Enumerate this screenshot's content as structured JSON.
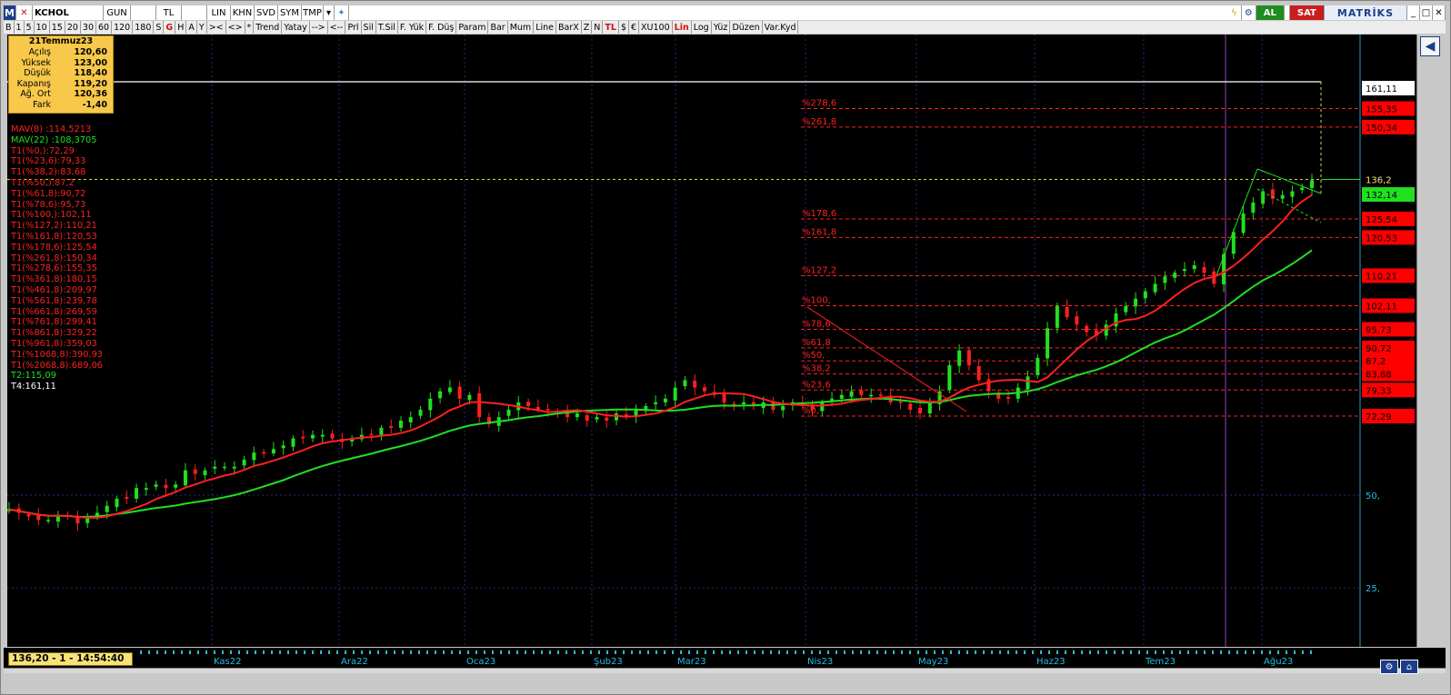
{
  "toolbar_top": {
    "logo": "M",
    "symbol": "KCHOL",
    "period": "GUN",
    "currency": "TL",
    "scale": "LIN",
    "khn": "KHN",
    "svd": "SVD",
    "sym": "SYM",
    "tmp": "TMP",
    "al_label": "AL",
    "sat_label": "SAT",
    "brand": "MATRİKS"
  },
  "toolbar_bottom": {
    "items": [
      "B",
      "1",
      "5",
      "10",
      "15",
      "20",
      "30",
      "60",
      "120",
      "180",
      "S",
      "G",
      "H",
      "A",
      "Y",
      "><",
      "<>",
      "*",
      "Trend",
      "Yatay",
      "-->",
      "<--",
      "Prl",
      "Sil",
      "T.Sil",
      "F. Yük",
      "F. Düş",
      "Param",
      "Bar",
      "Mum",
      "Line",
      "BarX",
      "Z",
      "N",
      "TL",
      "$",
      "€",
      "XU100",
      "Lin",
      "Log",
      "Yüz",
      "Düzen",
      "Var.Kyd"
    ],
    "red_items": [
      "G",
      "TL",
      "Lin"
    ]
  },
  "infobox": {
    "date": "21Temmuz23",
    "rows": [
      {
        "k": "Açılış",
        "v": "120,60"
      },
      {
        "k": "Yüksek",
        "v": "123,00"
      },
      {
        "k": "Düşük",
        "v": "118,40"
      },
      {
        "k": "Kapanış",
        "v": "119,20"
      },
      {
        "k": "Ağ. Ort",
        "v": "120,36"
      },
      {
        "k": "Fark",
        "v": "-1,40"
      }
    ]
  },
  "legend": {
    "lines": [
      {
        "text": "MAV(8)        :114,5213",
        "color": "#ff2020"
      },
      {
        "text": "MAV(22)       :108,3705",
        "color": "#20e020"
      },
      {
        "text": "T1(%0,):72,29",
        "color": "#ff2020"
      },
      {
        "text": "T1(%23,6):79,33",
        "color": "#ff2020"
      },
      {
        "text": "T1(%38,2):83,68",
        "color": "#ff2020"
      },
      {
        "text": "T1(%50,):87,2",
        "color": "#ff2020"
      },
      {
        "text": "T1(%61,8):90,72",
        "color": "#ff2020"
      },
      {
        "text": "T1(%78,6):95,73",
        "color": "#ff2020"
      },
      {
        "text": "T1(%100,):102,11",
        "color": "#ff2020"
      },
      {
        "text": "T1(%127,2):110,21",
        "color": "#ff2020"
      },
      {
        "text": "T1(%161,8):120,53",
        "color": "#ff2020"
      },
      {
        "text": "T1(%178,6):125,54",
        "color": "#ff2020"
      },
      {
        "text": "T1(%261,8):150,34",
        "color": "#ff2020"
      },
      {
        "text": "T1(%278,6):155,35",
        "color": "#ff2020"
      },
      {
        "text": "T1(%361,8):180,15",
        "color": "#ff2020"
      },
      {
        "text": "T1(%461,8):209,97",
        "color": "#ff2020"
      },
      {
        "text": "T1(%561,8):239,78",
        "color": "#ff2020"
      },
      {
        "text": "T1(%661,8):269,59",
        "color": "#ff2020"
      },
      {
        "text": "T1(%761,8):299,41",
        "color": "#ff2020"
      },
      {
        "text": "T1(%861,8):329,22",
        "color": "#ff2020"
      },
      {
        "text": "T1(%961,8):359,03",
        "color": "#ff2020"
      },
      {
        "text": "T1(%1068,8):390,93",
        "color": "#ff2020"
      },
      {
        "text": "T1(%2068,8):689,06",
        "color": "#ff2020"
      },
      {
        "text": "T2:115,09",
        "color": "#20e020"
      },
      {
        "text": "T4:161,11",
        "color": "#ffffff"
      }
    ]
  },
  "status": {
    "price_time": "136,20 - 1 - 14:54:40"
  },
  "chart_data": {
    "type": "candlestick",
    "symbol": "KCHOL",
    "x_labels": [
      "Kas22",
      "Ara22",
      "Oca23",
      "Şub23",
      "Mar23",
      "Nis23",
      "May23",
      "Haz23",
      "Tem23",
      "Ağu23"
    ],
    "y_ticks": [
      "25,",
      "50,"
    ],
    "fib_levels": [
      {
        "label": "%0,",
        "value": 72.29,
        "right_label": "72,29"
      },
      {
        "label": "%23,6",
        "value": 79.33,
        "right_label": "79,33"
      },
      {
        "label": "%38,2",
        "value": 83.68,
        "right_label": "83,68"
      },
      {
        "label": "%50,",
        "value": 87.2,
        "right_label": "87,2"
      },
      {
        "label": "%61,8",
        "value": 90.72,
        "right_label": "90,72"
      },
      {
        "label": "%78,6",
        "value": 95.73,
        "right_label": "95,73"
      },
      {
        "label": "%100,",
        "value": 102.11,
        "right_label": "102,11"
      },
      {
        "label": "%127,2",
        "value": 110.21,
        "right_label": "110,21"
      },
      {
        "label": "%161,8",
        "value": 120.53,
        "right_label": "120,53"
      },
      {
        "label": "%178,6",
        "value": 125.54,
        "right_label": "125,54"
      },
      {
        "label": "%261,8",
        "value": 150.34,
        "right_label": "150,34"
      },
      {
        "label": "%278,6",
        "value": 155.35,
        "right_label": "155,35"
      }
    ],
    "last_price": {
      "label": "136,2",
      "value": 136.2
    },
    "ma8_last": {
      "label": "132,14",
      "value": 132.14
    },
    "t4": {
      "label": "161,11",
      "value": 161.11
    },
    "ma_series": [
      {
        "name": "MAV(8)",
        "color": "#ff2020"
      },
      {
        "name": "MAV(22)",
        "color": "#20e020"
      }
    ],
    "closes": [
      46,
      45,
      44,
      43,
      43,
      44,
      44,
      42,
      44,
      45,
      47,
      49,
      49,
      52,
      52,
      53,
      52,
      53,
      57,
      56,
      57,
      58,
      58,
      58,
      60,
      62,
      62,
      63,
      64,
      66,
      66,
      67,
      67,
      66,
      65,
      66,
      67,
      67,
      69,
      69,
      71,
      72,
      74,
      77,
      79,
      80,
      77,
      78,
      72,
      70,
      72,
      74,
      76,
      75,
      74,
      74,
      73,
      72,
      73,
      71,
      72,
      71,
      73,
      72,
      74,
      75,
      76,
      77,
      80,
      82,
      80,
      79,
      78,
      76,
      75,
      76,
      75,
      76,
      74,
      75,
      76,
      75,
      74,
      76,
      77,
      78,
      79,
      78,
      78,
      78,
      76,
      76,
      74,
      73,
      76,
      79,
      86,
      90,
      86,
      82,
      79,
      77,
      77,
      80,
      83,
      88,
      96,
      102,
      99,
      97,
      95,
      94,
      97,
      100,
      102,
      104,
      106,
      108,
      110,
      111,
      112,
      113,
      111,
      108,
      116,
      122,
      127,
      130,
      133,
      131,
      132,
      133,
      134,
      136
    ],
    "colors": {
      "up": "#20e020",
      "down": "#ff2020",
      "fib": "#ff2020",
      "t4": "#ffffff",
      "last": "#f7e27a",
      "ma8": "#ff2020",
      "ma22": "#20e020"
    }
  }
}
